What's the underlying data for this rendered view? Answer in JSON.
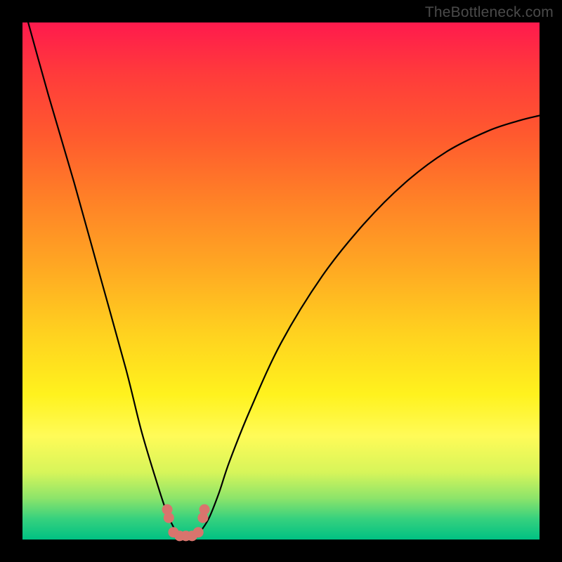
{
  "watermark": "TheBottleneck.com",
  "chart_data": {
    "type": "line",
    "title": "",
    "xlabel": "",
    "ylabel": "",
    "xlim": [
      0,
      100
    ],
    "ylim": [
      0,
      100
    ],
    "series": [
      {
        "name": "bottleneck-curve",
        "x": [
          0,
          5,
          10,
          15,
          20,
          23,
          26,
          28,
          30,
          31,
          32,
          33,
          34,
          36,
          38,
          40,
          44,
          50,
          58,
          66,
          74,
          82,
          90,
          96,
          100
        ],
        "y": [
          104,
          86,
          69,
          51,
          33,
          21,
          11,
          5,
          1,
          0,
          0,
          0,
          1,
          4,
          9,
          15,
          25,
          38,
          51,
          61,
          69,
          75,
          79,
          81,
          82
        ]
      }
    ],
    "decorations": [
      {
        "name": "bead-cluster",
        "color_hex": "#d9746d",
        "points": [
          {
            "x": 28.0,
            "y": 5.8
          },
          {
            "x": 28.3,
            "y": 4.2
          },
          {
            "x": 29.2,
            "y": 1.4
          },
          {
            "x": 30.4,
            "y": 0.7
          },
          {
            "x": 31.6,
            "y": 0.7
          },
          {
            "x": 32.8,
            "y": 0.7
          },
          {
            "x": 34.0,
            "y": 1.4
          },
          {
            "x": 34.9,
            "y": 4.2
          },
          {
            "x": 35.2,
            "y": 5.8
          }
        ],
        "radius_px": 7.5
      }
    ],
    "gradient_stops": [
      {
        "pos": 0.0,
        "hex": "#ff1a4d"
      },
      {
        "pos": 0.1,
        "hex": "#ff3b3b"
      },
      {
        "pos": 0.22,
        "hex": "#ff5a2e"
      },
      {
        "pos": 0.34,
        "hex": "#ff8027"
      },
      {
        "pos": 0.46,
        "hex": "#ffa423"
      },
      {
        "pos": 0.6,
        "hex": "#ffd11f"
      },
      {
        "pos": 0.72,
        "hex": "#fff21e"
      },
      {
        "pos": 0.8,
        "hex": "#fffb58"
      },
      {
        "pos": 0.87,
        "hex": "#d7f55a"
      },
      {
        "pos": 0.92,
        "hex": "#8de46a"
      },
      {
        "pos": 0.96,
        "hex": "#36d17e"
      },
      {
        "pos": 1.0,
        "hex": "#00c183"
      }
    ]
  }
}
